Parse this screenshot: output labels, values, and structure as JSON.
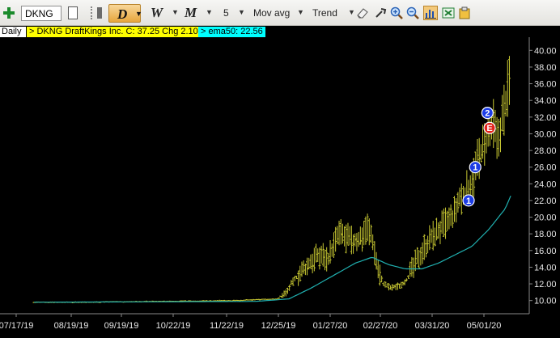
{
  "toolbar": {
    "symbol": "DKNG",
    "period": "D",
    "weekly": "W",
    "monthly": "M",
    "count": "5",
    "indicator": "Mov avg",
    "tool": "Trend",
    "icons": [
      "add-icon",
      "new-page-icon",
      "eraser-icon",
      "pan-icon",
      "zoom-in-icon",
      "zoom-out-icon",
      "chart-bars-icon",
      "export-icon",
      "clipboard-icon"
    ]
  },
  "info": {
    "interval": "Daily",
    "quote": "> DKNG  DraftKings Inc.  C: 37.25  Chg 2.10",
    "ema": "> ema50: 22.56"
  },
  "colors": {
    "background": "#000000",
    "bars": "#c8c832",
    "ema": "#20b0b0",
    "quote_bg": "#ffff00",
    "ema_bg": "#00ffff",
    "marker_blue": "#1d3de6",
    "marker_red": "#e3231b"
  },
  "chart_data": {
    "type": "ohlc",
    "y_ticks": [
      "10.00",
      "12.00",
      "14.00",
      "16.00",
      "18.00",
      "20.00",
      "22.00",
      "24.00",
      "26.00",
      "28.00",
      "30.00",
      "32.00",
      "34.00",
      "36.00",
      "38.00",
      "40.00"
    ],
    "x_ticks": [
      "07/17/19",
      "08/19/19",
      "09/19/19",
      "10/22/19",
      "11/22/19",
      "12/25/19",
      "01/27/20",
      "02/27/20",
      "03/31/20",
      "05/01/20"
    ],
    "ylim": [
      9.0,
      41.0
    ],
    "price_path": [
      [
        0,
        9.8
      ],
      [
        40,
        9.8
      ],
      [
        80,
        9.85
      ],
      [
        110,
        9.9
      ],
      [
        150,
        9.95
      ],
      [
        180,
        10.0
      ],
      [
        200,
        10.1
      ],
      [
        220,
        10.2
      ],
      [
        225,
        10.8
      ],
      [
        228,
        11.0
      ],
      [
        232,
        12.0
      ],
      [
        238,
        13.0
      ],
      [
        246,
        14.0
      ],
      [
        252,
        15.0
      ],
      [
        260,
        15.5
      ],
      [
        265,
        15.0
      ],
      [
        270,
        16.5
      ],
      [
        275,
        18.0
      ],
      [
        282,
        17.5
      ],
      [
        288,
        17.0
      ],
      [
        295,
        17.5
      ],
      [
        300,
        19.0
      ],
      [
        305,
        17.5
      ],
      [
        310,
        14.0
      ],
      [
        315,
        12.0
      ],
      [
        322,
        11.5
      ],
      [
        330,
        11.8
      ],
      [
        336,
        12.5
      ],
      [
        342,
        14.0
      ],
      [
        348,
        15.5
      ],
      [
        355,
        17.0
      ],
      [
        362,
        18.0
      ],
      [
        370,
        19.0
      ],
      [
        378,
        20.0
      ],
      [
        384,
        22.0
      ],
      [
        390,
        23.0
      ],
      [
        396,
        24.5
      ],
      [
        400,
        26.5
      ],
      [
        404,
        28.0
      ],
      [
        410,
        29.5
      ],
      [
        414,
        31.0
      ],
      [
        418,
        29.0
      ],
      [
        422,
        31.5
      ],
      [
        426,
        34.0
      ],
      [
        430,
        37.25
      ]
    ],
    "ema_path": [
      [
        0,
        9.8
      ],
      [
        200,
        9.9
      ],
      [
        230,
        10.2
      ],
      [
        250,
        11.5
      ],
      [
        270,
        13.0
      ],
      [
        290,
        14.5
      ],
      [
        305,
        15.2
      ],
      [
        320,
        14.3
      ],
      [
        335,
        13.8
      ],
      [
        350,
        13.8
      ],
      [
        365,
        14.5
      ],
      [
        380,
        15.5
      ],
      [
        395,
        16.5
      ],
      [
        410,
        18.5
      ],
      [
        425,
        21.0
      ],
      [
        430,
        22.56
      ]
    ],
    "markers": [
      {
        "label": "1",
        "color": "blue",
        "x": 392,
        "y": 22.0
      },
      {
        "label": "1",
        "color": "blue",
        "x": 398,
        "y": 26.0
      },
      {
        "label": "2",
        "color": "blue",
        "x": 409,
        "y": 32.5
      },
      {
        "label": "E",
        "color": "red",
        "x": 411,
        "y": 30.7
      }
    ]
  }
}
